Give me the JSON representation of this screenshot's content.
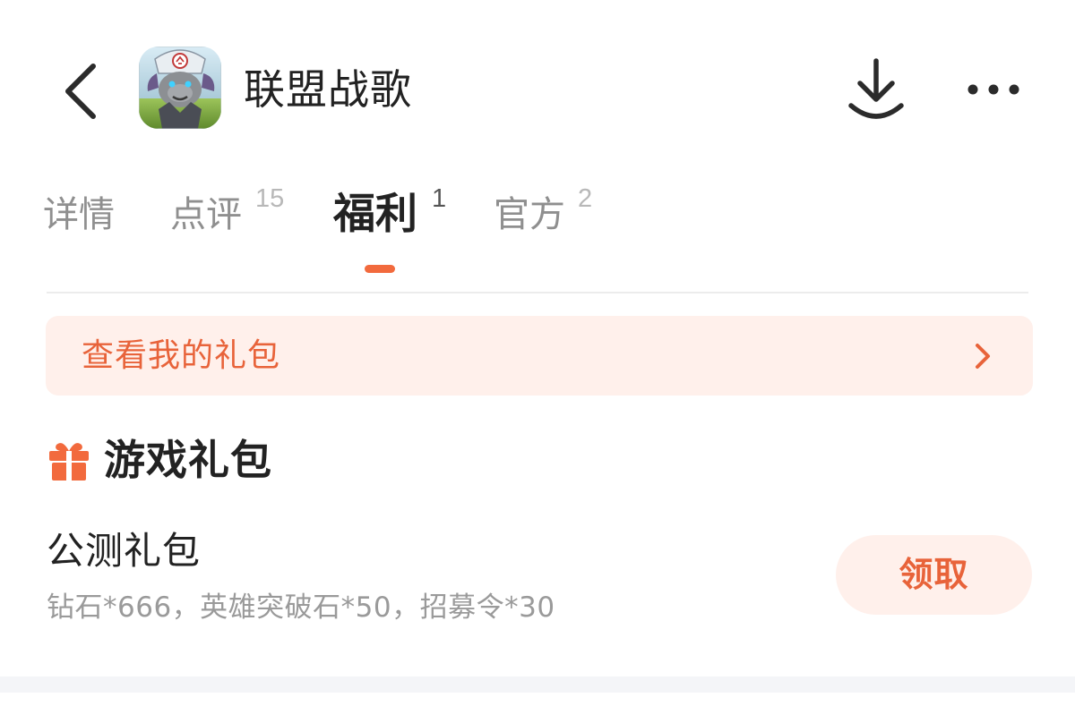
{
  "header": {
    "app_title": "联盟战歌",
    "icons": {
      "back": "chevron-left-icon",
      "download": "download-icon",
      "more": "more-horizontal-icon"
    }
  },
  "tabs": [
    {
      "label": "详情",
      "count": ""
    },
    {
      "label": "点评",
      "count": "15"
    },
    {
      "label": "福利",
      "count": "1",
      "active": true
    },
    {
      "label": "官方",
      "count": "2"
    }
  ],
  "my_gifts_banner": {
    "label": "查看我的礼包",
    "icon": "chevron-right-icon"
  },
  "game_gifts_section": {
    "title": "游戏礼包",
    "icon": "gift-icon",
    "packages": [
      {
        "name": "公测礼包",
        "description": "钻石*666，英雄突破石*50，招募令*30",
        "claim_label": "领取"
      }
    ]
  },
  "colors": {
    "accent": "#f26a3d",
    "accent_text": "#e8633a",
    "accent_bg": "#fff0eb",
    "text_primary": "#222222",
    "text_secondary": "#9a9a9a"
  }
}
